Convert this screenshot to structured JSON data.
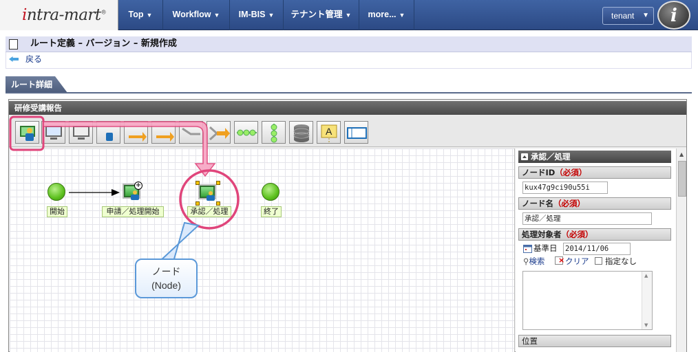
{
  "topnav": {
    "logo": "intra-mart",
    "items": [
      {
        "label": "Top"
      },
      {
        "label": "Workflow"
      },
      {
        "label": "IM-BIS"
      },
      {
        "label": "テナント管理"
      },
      {
        "label": "more..."
      }
    ],
    "tenant_label": "tenant",
    "avatar_letter": "i"
  },
  "page": {
    "title": "ルート定義 – バージョン – 新規作成",
    "back_label": "戻る",
    "tab_label": "ルート詳細"
  },
  "route": {
    "name": "研修受講報告",
    "toolbar_tools": [
      "user-node-icon",
      "monitor-node-icon",
      "monitor-node-icon",
      "approval-node-icon",
      "branch-node-icon",
      "branch-node-icon",
      "merge-node-icon",
      "merge-node-icon",
      "sequence-node-icon",
      "parallel-node-icon",
      "database-node-icon",
      "label-node-icon",
      "frame-node-icon"
    ],
    "nodes": {
      "start": "開始",
      "apply": "申請／処理開始",
      "approve": "承認／処理",
      "end": "終了"
    }
  },
  "properties": {
    "header": "承認／処理",
    "node_id_label": "ノードID",
    "required_mark": "（必須）",
    "node_id_value": "kux47g9ci90u55i",
    "node_name_label": "ノード名",
    "node_name_value": "承認／処理",
    "target_label": "処理対象者",
    "base_date_label": "基準日",
    "base_date_value": "2014/11/06",
    "search_label": "検索",
    "clear_label": "クリア",
    "unspecified_label": "指定なし",
    "position_label": "位置"
  },
  "callout": {
    "line1": "ノード",
    "line2": "(Node)"
  },
  "colors": {
    "nav_blue": "#2c4a85",
    "highlight_pink": "#e0457b",
    "node_green": "#5cc01e"
  }
}
